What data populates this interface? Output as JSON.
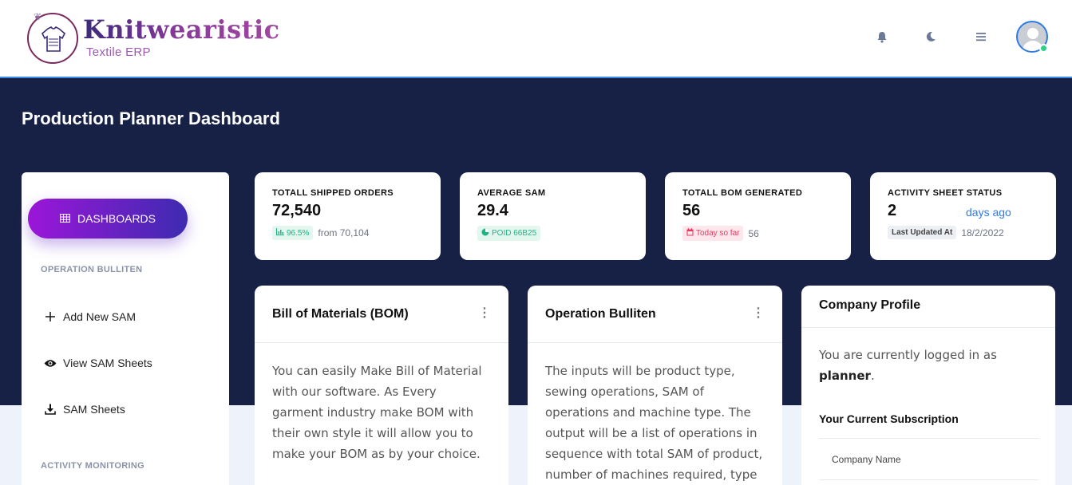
{
  "header": {
    "brand": "Knitwearistic",
    "brand_sub": "Textile ERP",
    "icons": [
      "bell-icon",
      "moon-icon",
      "menu-icon"
    ]
  },
  "page": {
    "title": "Production Planner Dashboard"
  },
  "sidebar": {
    "dashboards_label": "DASHBOARDS",
    "section_operation": "OPERATION BULLITEN",
    "items": [
      {
        "label": "Add New SAM",
        "icon": "plus-icon"
      },
      {
        "label": "View SAM Sheets",
        "icon": "eye-icon"
      },
      {
        "label": "SAM Sheets",
        "icon": "download-icon"
      }
    ],
    "section_activity": "ACTIVITY MONITORING"
  },
  "stats": [
    {
      "label": "TOTALL SHIPPED ORDERS",
      "value": "72,540",
      "pill": "96.5%",
      "foot": "from 70,104"
    },
    {
      "label": "AVERAGE SAM",
      "value": "29.4",
      "pill": "POID 66B25",
      "foot": ""
    },
    {
      "label": "TOTALL BOM GENERATED",
      "value": "56",
      "pill": "Today so far",
      "foot": "56"
    },
    {
      "label": "ACTIVITY SHEET STATUS",
      "value": "2",
      "extra": "days ago",
      "pill": "Last Updated At",
      "foot": "18/2/2022"
    }
  ],
  "cards": {
    "bom": {
      "title": "Bill of Materials (BOM)",
      "body": "You can easily Make Bill of Material with our software. As Every garment industry make BOM with their own style it will allow you to make your BOM as by your choice."
    },
    "operation": {
      "title": "Operation Bulliten",
      "body": "The inputs will be product type, sewing operations, SAM of operations and machine type. The output will be a list of operations in sequence with total SAM of product, number of machines required, type"
    }
  },
  "profile": {
    "title": "Company Profile",
    "text_prefix": "You are currently logged in as",
    "user": "planner",
    "subscription_title": "Your Current Subscription",
    "company_name_label": "Company Name"
  },
  "colors": {
    "hero": "#172145",
    "accent_blue": "#2f7ae5",
    "button_gradient_start": "#9b16d8",
    "button_gradient_end": "#3e2bb0",
    "online": "#2dcf8a"
  }
}
